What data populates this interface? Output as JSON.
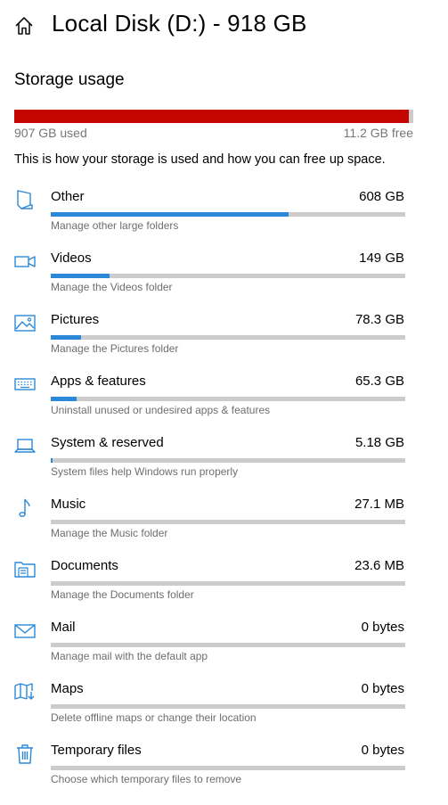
{
  "header": {
    "title": "Local Disk (D:) - 918 GB",
    "home_icon": "home-icon"
  },
  "storage": {
    "section_title": "Storage usage",
    "used_label": "907 GB used",
    "free_label": "11.2 GB free",
    "used_fraction": 0.988,
    "bar_color": "#c50500",
    "description": "This is how your storage is used and how you can free up space."
  },
  "accent_color": "#2b88d8",
  "categories": [
    {
      "name": "Other",
      "size": "608 GB",
      "subtitle": "Manage other large folders",
      "fraction": 0.67,
      "icon": "folder-other-icon"
    },
    {
      "name": "Videos",
      "size": "149 GB",
      "subtitle": "Manage the Videos folder",
      "fraction": 0.165,
      "icon": "video-camera-icon"
    },
    {
      "name": "Pictures",
      "size": "78.3 GB",
      "subtitle": "Manage the Pictures folder",
      "fraction": 0.085,
      "icon": "picture-icon"
    },
    {
      "name": "Apps & features",
      "size": "65.3 GB",
      "subtitle": "Uninstall unused or undesired apps & features",
      "fraction": 0.072,
      "icon": "keyboard-icon"
    },
    {
      "name": "System & reserved",
      "size": "5.18 GB",
      "subtitle": "System files help Windows run properly",
      "fraction": 0.006,
      "icon": "laptop-icon"
    },
    {
      "name": "Music",
      "size": "27.1 MB",
      "subtitle": "Manage the Music folder",
      "fraction": 0,
      "icon": "music-note-icon"
    },
    {
      "name": "Documents",
      "size": "23.6 MB",
      "subtitle": "Manage the Documents folder",
      "fraction": 0,
      "icon": "documents-folder-icon"
    },
    {
      "name": "Mail",
      "size": "0 bytes",
      "subtitle": "Manage mail with the default app",
      "fraction": 0,
      "icon": "mail-icon"
    },
    {
      "name": "Maps",
      "size": "0 bytes",
      "subtitle": "Delete offline maps or change their location",
      "fraction": 0,
      "icon": "map-icon"
    },
    {
      "name": "Temporary files",
      "size": "0 bytes",
      "subtitle": "Choose which temporary files to remove",
      "fraction": 0,
      "icon": "trash-icon"
    }
  ]
}
